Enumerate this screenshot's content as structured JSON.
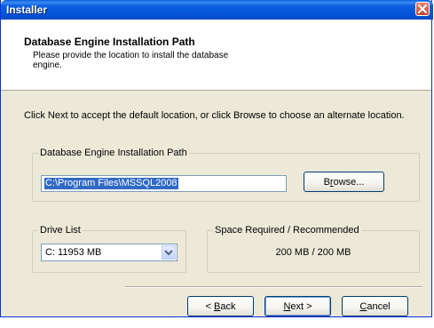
{
  "window": {
    "title": "Installer"
  },
  "header": {
    "title": "Database Engine Installation Path",
    "subtitle": "Please provide the location to install the database engine."
  },
  "instruction": "Click Next to accept the default location, or click Browse to choose an alternate location.",
  "path_group": {
    "legend": "Database Engine Installation Path",
    "value": "C:\\Program Files\\MSSQL2008",
    "browse_pre": "B",
    "browse_mn": "r",
    "browse_post": "owse..."
  },
  "drive_group": {
    "legend": "Drive List",
    "selected": "C:  11953 MB"
  },
  "space_group": {
    "legend": "Space Required / Recommended",
    "value": "200 MB / 200 MB"
  },
  "footer": {
    "back_pre": "< ",
    "back_mn": "B",
    "back_post": "ack",
    "next_mn": "N",
    "next_post": "ext >",
    "cancel_mn": "C",
    "cancel_post": "ancel"
  },
  "icons": {
    "close": "close-icon",
    "dropdown": "chevron-down-icon"
  },
  "colors": {
    "titlebar": "#0a5fd8",
    "selection": "#316ac5",
    "dialog_bg": "#ece9d8"
  }
}
